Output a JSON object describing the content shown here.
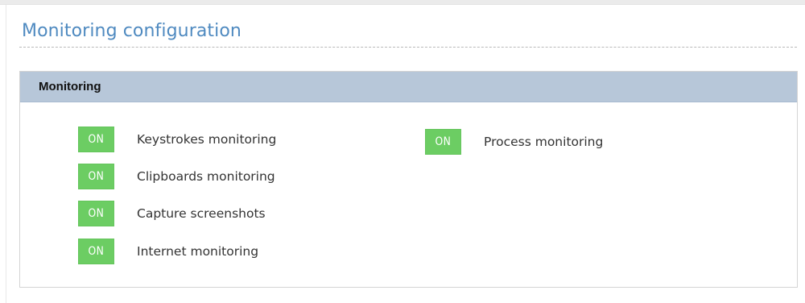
{
  "page": {
    "title": "Monitoring configuration"
  },
  "panel": {
    "title": "Monitoring"
  },
  "colors": {
    "heading": "#4f8ac0",
    "panel_header_bg": "#b7c7d9",
    "toggle_on": "#6ccd63"
  },
  "toggles": {
    "keystrokes": {
      "state": "ON",
      "label": "Keystrokes monitoring"
    },
    "clipboards": {
      "state": "ON",
      "label": "Clipboards monitoring"
    },
    "screenshots": {
      "state": "ON",
      "label": "Capture screenshots"
    },
    "internet": {
      "state": "ON",
      "label": "Internet monitoring"
    },
    "process": {
      "state": "ON",
      "label": "Process monitoring"
    }
  }
}
